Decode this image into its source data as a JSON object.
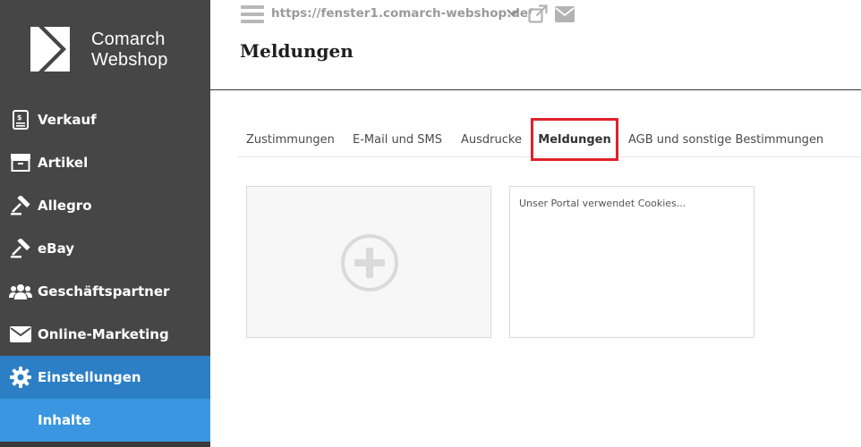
{
  "brand": {
    "line1": "Comarch",
    "line2": "Webshop"
  },
  "sidebar": {
    "items": [
      {
        "label": "Verkauf",
        "icon": "invoice-icon"
      },
      {
        "label": "Artikel",
        "icon": "box-icon"
      },
      {
        "label": "Allegro",
        "icon": "gavel-icon"
      },
      {
        "label": "eBay",
        "icon": "gavel-icon"
      },
      {
        "label": "Geschäftspartner",
        "icon": "users-icon"
      },
      {
        "label": "Online-Marketing",
        "icon": "envelope-icon"
      },
      {
        "label": "Einstellungen",
        "icon": "gear-icon",
        "active": true
      },
      {
        "label": "Inhalte",
        "sub": true
      }
    ]
  },
  "topbar": {
    "url": "https://fenster1.comarch-webshop.de/"
  },
  "page": {
    "title": "Meldungen"
  },
  "tabs": [
    {
      "label": "Zustimmungen"
    },
    {
      "label": "E-Mail und SMS"
    },
    {
      "label": "Ausdrucke"
    },
    {
      "label": "Meldungen",
      "active": true
    },
    {
      "label": "AGB und sonstige Bestimmungen"
    }
  ],
  "cards": {
    "message_preview": "Unser Portal verwendet Cookies..."
  },
  "colors": {
    "sidebar_bg": "#464646",
    "active_bg": "#2c7fc4",
    "sub_bg": "#3a96e0",
    "highlight": "#e0202b"
  }
}
